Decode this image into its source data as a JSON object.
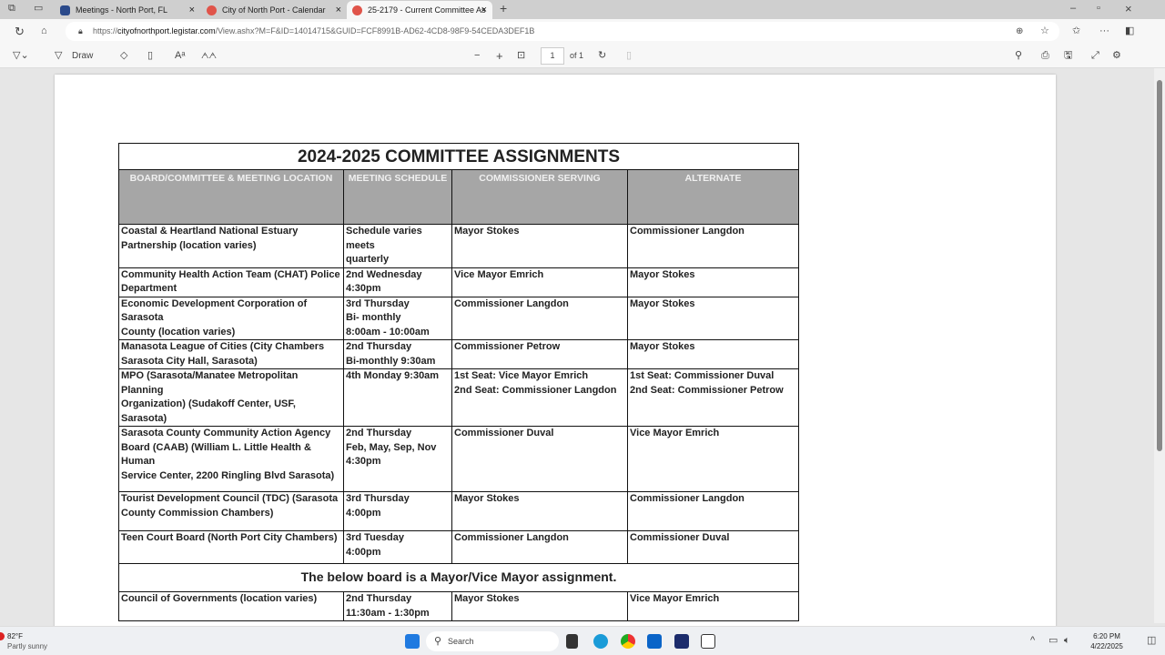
{
  "browser": {
    "tabs": [
      {
        "label": "Meetings - North Port, FL",
        "color": "#2b4a8a"
      },
      {
        "label": "City of North Port - Calendar",
        "color": "#e0544a"
      },
      {
        "label": "25-2179 - Current Committee As",
        "color": "#e0544a",
        "active": true
      }
    ],
    "url_prefix": "https://",
    "url_domain": "cityofnorthport.legistar.com",
    "url_path": "/View.ashx?M=F&ID=14014715&GUID=FCF8991B-AD62-4CD8-98F9-54CEDA3DEF1B"
  },
  "pdf_toolbar": {
    "draw_label": "Draw",
    "page_number": "1",
    "page_total": "of 1"
  },
  "document": {
    "title": "2024-2025 COMMITTEE ASSIGNMENTS",
    "headers": [
      "BOARD/COMMITTEE & MEETING LOCATION",
      "MEETING SCHEDULE",
      "COMMISSIONER SERVING",
      "ALTERNATE"
    ],
    "rows": [
      {
        "cells": [
          "Coastal & Heartland National Estuary\nPartnership (location varies)",
          "Schedule varies meets\nquarterly",
          "Mayor Stokes",
          "Commissioner Langdon"
        ]
      },
      {
        "cells": [
          "Community Health Action Team (CHAT) Police\nDepartment",
          "2nd Wednesday\n4:30pm",
          "Vice Mayor Emrich",
          "Mayor Stokes"
        ]
      },
      {
        "cells": [
          "Economic Development Corporation of Sarasota\nCounty (location varies)",
          "3rd Thursday\nBi- monthly\n8:00am - 10:00am",
          "Commissioner Langdon",
          "Mayor Stokes"
        ]
      },
      {
        "cells": [
          "Manasota League of Cities (City Chambers\nSarasota City Hall, Sarasota)",
          "2nd Thursday\nBi-monthly 9:30am",
          "Commissioner Petrow",
          "Mayor Stokes"
        ]
      },
      {
        "cells": [
          "MPO (Sarasota/Manatee Metropolitan Planning\nOrganization) (Sudakoff Center, USF, Sarasota)",
          "4th Monday 9:30am",
          "1st Seat: Vice Mayor Emrich\n2nd Seat: Commissioner Langdon",
          "1st Seat: Commissioner Duval\n2nd Seat: Commissioner Petrow"
        ]
      },
      {
        "cells": [
          "Sarasota County Community Action Agency\nBoard (CAAB) (William L. Little Health & Human\nService Center, 2200 Ringling Blvd Sarasota)",
          "2nd Thursday\nFeb, May, Sep, Nov\n4:30pm",
          "Commissioner Duval",
          "Vice Mayor Emrich"
        ]
      },
      {
        "cells": [
          "Tourist Development Council (TDC) (Sarasota\nCounty Commission Chambers)",
          "3rd Thursday\n4:00pm",
          "Mayor Stokes",
          "Commissioner Langdon"
        ]
      },
      {
        "cells": [
          "Teen Court Board (North Port City Chambers)",
          "3rd Tuesday\n4:00pm",
          "Commissioner Langdon",
          "Commissioner Duval"
        ]
      }
    ],
    "note": "The below board is a Mayor/Vice Mayor assignment.",
    "final_rows": [
      {
        "cells": [
          "Council of Governments (location varies)",
          "2nd Thursday\n11:30am - 1:30pm",
          "Mayor Stokes",
          "Vice Mayor Emrich"
        ]
      }
    ]
  },
  "taskbar": {
    "temp": "82°F",
    "weather": "Partly sunny",
    "search_placeholder": "Search",
    "time": "6:20 PM",
    "date": "4/22/2025"
  }
}
